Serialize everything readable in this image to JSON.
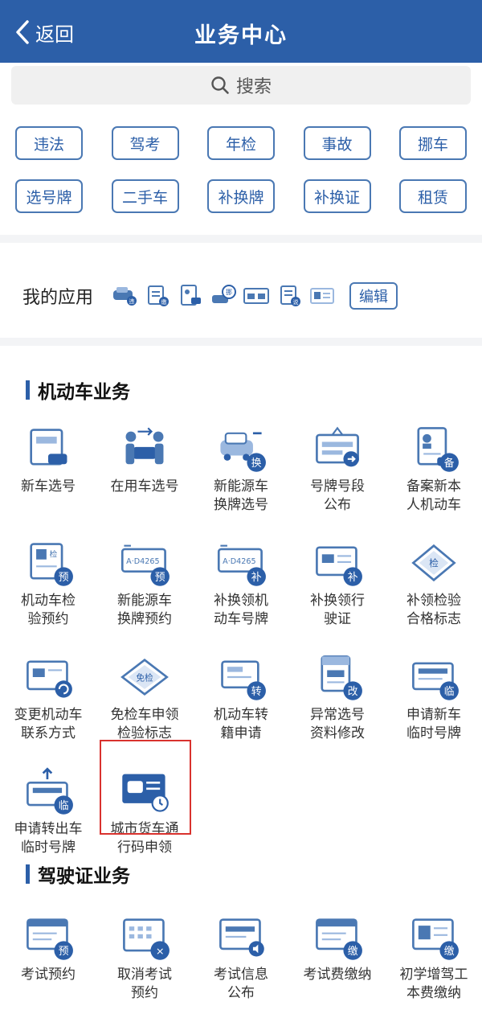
{
  "header": {
    "back_label": "返回",
    "title": "业务中心"
  },
  "search": {
    "placeholder": "搜索"
  },
  "quick_tags": [
    [
      "违法",
      "驾考",
      "年检",
      "事故",
      "挪车"
    ],
    [
      "选号牌",
      "二手车",
      "补换牌",
      "补换证",
      "租赁"
    ]
  ],
  "my_apps": {
    "label": "我的应用",
    "edit_label": "编辑",
    "icon_badges": [
      "违",
      "缴",
      "",
      "挪",
      "",
      "说",
      ""
    ]
  },
  "vehicle_section": {
    "title": "机动车业务",
    "items": [
      {
        "line1": "新车选号",
        "line2": "",
        "icon": "new-car-number-icon",
        "badge": ""
      },
      {
        "line1": "在用车选号",
        "line2": "",
        "icon": "used-car-number-icon",
        "badge": ""
      },
      {
        "line1": "新能源车",
        "line2": "换牌选号",
        "icon": "ev-plate-select-icon",
        "badge": "换"
      },
      {
        "line1": "号牌号段",
        "line2": "公布",
        "icon": "plate-segment-icon",
        "badge": ""
      },
      {
        "line1": "备案新本",
        "line2": "人机动车",
        "icon": "register-vehicle-icon",
        "badge": "备"
      },
      {
        "line1": "机动车检",
        "line2": "验预约",
        "icon": "inspection-booking-icon",
        "badge": "预"
      },
      {
        "line1": "新能源车",
        "line2": "换牌预约",
        "icon": "ev-plate-booking-icon",
        "badge": "预",
        "plate": "A·D4265"
      },
      {
        "line1": "补换领机",
        "line2": "动车号牌",
        "icon": "replace-plate-icon",
        "badge": "补",
        "plate": "A·D4265"
      },
      {
        "line1": "补换领行",
        "line2": "驶证",
        "icon": "replace-license-icon",
        "badge": "补"
      },
      {
        "line1": "补领检验",
        "line2": "合格标志",
        "icon": "inspection-mark-icon",
        "badge": "检"
      },
      {
        "line1": "变更机动车",
        "line2": "联系方式",
        "icon": "change-contact-icon",
        "badge": ""
      },
      {
        "line1": "免检车申领",
        "line2": "检验标志",
        "icon": "exempt-mark-icon",
        "badge": "免检"
      },
      {
        "line1": "机动车转",
        "line2": "籍申请",
        "icon": "transfer-icon",
        "badge": "转"
      },
      {
        "line1": "异常选号",
        "line2": "资料修改",
        "icon": "abnormal-number-icon",
        "badge": "改"
      },
      {
        "line1": "申请新车",
        "line2": "临时号牌",
        "icon": "temp-plate-new-icon",
        "badge": "临"
      },
      {
        "line1": "申请转出车",
        "line2": "临时号牌",
        "icon": "temp-plate-out-icon",
        "badge": "临"
      },
      {
        "line1": "城市货车通",
        "line2": "行码申领",
        "icon": "truck-pass-icon",
        "badge": ""
      }
    ]
  },
  "license_section": {
    "title": "驾驶证业务",
    "items": [
      {
        "line1": "考试预约",
        "line2": "",
        "icon": "exam-booking-icon",
        "badge": "预"
      },
      {
        "line1": "取消考试",
        "line2": "预约",
        "icon": "cancel-exam-icon",
        "badge": "×"
      },
      {
        "line1": "考试信息",
        "line2": "公布",
        "icon": "exam-info-icon",
        "badge": ""
      },
      {
        "line1": "考试费缴纳",
        "line2": "",
        "icon": "exam-fee-icon",
        "badge": "缴"
      },
      {
        "line1": "初学增驾工",
        "line2": "本费缴纳",
        "icon": "learner-fee-icon",
        "badge": "缴"
      }
    ]
  },
  "colors": {
    "primary": "#2c5fa8",
    "highlight": "#d9322e"
  }
}
